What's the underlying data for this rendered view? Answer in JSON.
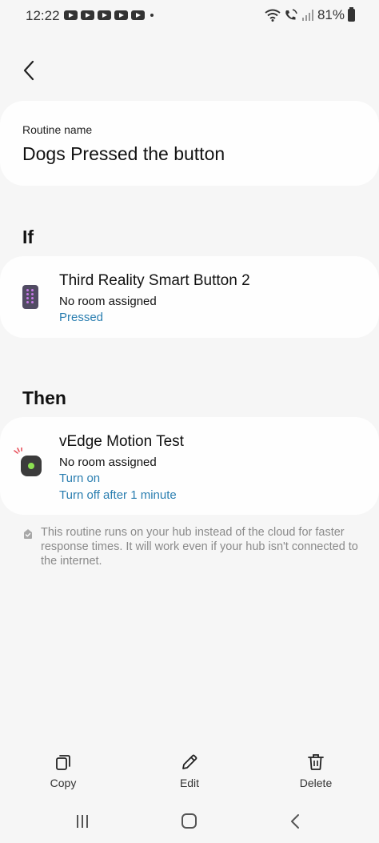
{
  "status_bar": {
    "time": "12:22",
    "battery": "81%"
  },
  "routine": {
    "name_label": "Routine name",
    "name_value": "Dogs Pressed the button"
  },
  "if_section": {
    "title": "If",
    "device": {
      "name": "Third Reality Smart Button 2",
      "room": "No room assigned",
      "condition": "Pressed",
      "icon": "button-remote-icon"
    }
  },
  "then_section": {
    "title": "Then",
    "device": {
      "name": "vEdge Motion Test",
      "room": "No room assigned",
      "action_1": "Turn on",
      "action_2": "Turn off after 1 minute",
      "icon": "motion-sensor-icon"
    }
  },
  "hub_note": "This routine runs on your hub instead of the cloud for faster response times. It will work even if your hub isn't connected to the internet.",
  "bottom_actions": {
    "copy": "Copy",
    "edit": "Edit",
    "delete": "Delete"
  },
  "colors": {
    "link": "#2a7eb0",
    "background": "#f6f6f6",
    "card": "#fefefe",
    "note": "#8a8a8a"
  }
}
